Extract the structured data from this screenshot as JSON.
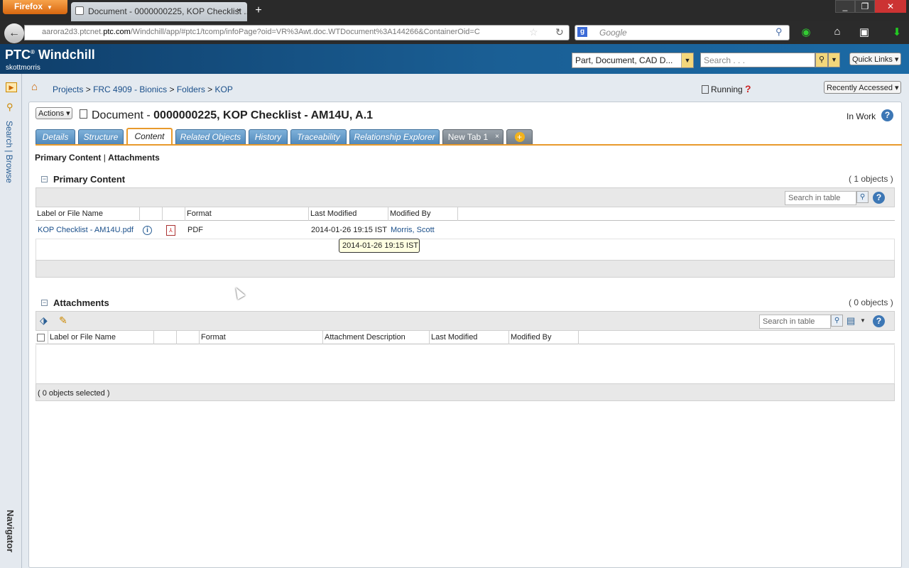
{
  "browser": {
    "menu_button": "Firefox",
    "tab_title": "Document - 0000000225, KOP Checklist ...",
    "tab_close": "×",
    "new_tab": "+",
    "url_prefix": "aarora2d3.ptcnet.",
    "url_domain": "ptc.com",
    "url_rest": "/Windchill/app/#ptc1/tcomp/infoPage?oid=VR%3Awt.doc.WTDocument%3A144266&ContainerOid=C",
    "search_engine_placeholder": "Google"
  },
  "header": {
    "logo_ptc": "PTC",
    "logo_reg": "®",
    "logo_product": "Windchill",
    "username": "skottmorris",
    "type_select": "Part, Document, CAD D...",
    "search_placeholder": "Search . . .",
    "quick_links": "Quick Links ▾"
  },
  "navigator": {
    "search_browse": "Search | Browse",
    "label": "Navigator"
  },
  "breadcrumb": {
    "items": [
      "Projects",
      "FRC 4909 - Bionics",
      "Folders",
      "KOP"
    ],
    "separator": ">"
  },
  "status": {
    "running": "Running",
    "recently_accessed": "Recently Accessed ▾"
  },
  "document": {
    "actions_label": "Actions ▾",
    "title_prefix": "Document - ",
    "title": "0000000225, KOP Checklist - AM14U, A.1",
    "state": "In Work"
  },
  "tabs": [
    {
      "label": "Details"
    },
    {
      "label": "Structure"
    },
    {
      "label": "Content"
    },
    {
      "label": "Related Objects"
    },
    {
      "label": "History"
    },
    {
      "label": "Traceability"
    },
    {
      "label": "Relationship Explorer"
    },
    {
      "label": "New Tab 1"
    }
  ],
  "new_tab_close": "×",
  "sublinks": {
    "primary": "Primary Content",
    "separator": "|",
    "attachments": "Attachments"
  },
  "primary_content": {
    "title": "Primary Content",
    "count": "( 1 objects )",
    "search_placeholder": "Search in table",
    "columns": [
      "Label or File Name",
      "",
      "",
      "Format",
      "Last Modified",
      "Modified By"
    ],
    "rows": [
      {
        "name": "KOP Checklist - AM14U.pdf",
        "format": "PDF",
        "last_modified": "2014-01-26 19:15 IST",
        "modified_by": "Morris, Scott"
      }
    ],
    "tooltip": "2014-01-26 19:15 IST"
  },
  "attachments": {
    "title": "Attachments",
    "count": "( 0 objects )",
    "search_placeholder": "Search in table",
    "columns": [
      "Label or File Name",
      "",
      "",
      "Format",
      "Attachment Description",
      "Last Modified",
      "Modified By"
    ],
    "footer": "( 0 objects selected )"
  },
  "colors": {
    "accent_orange": "#e89a2c",
    "tab_blue": "#5089bb",
    "header_blue": "#1a5f95",
    "link_blue": "#1a4f8a"
  }
}
